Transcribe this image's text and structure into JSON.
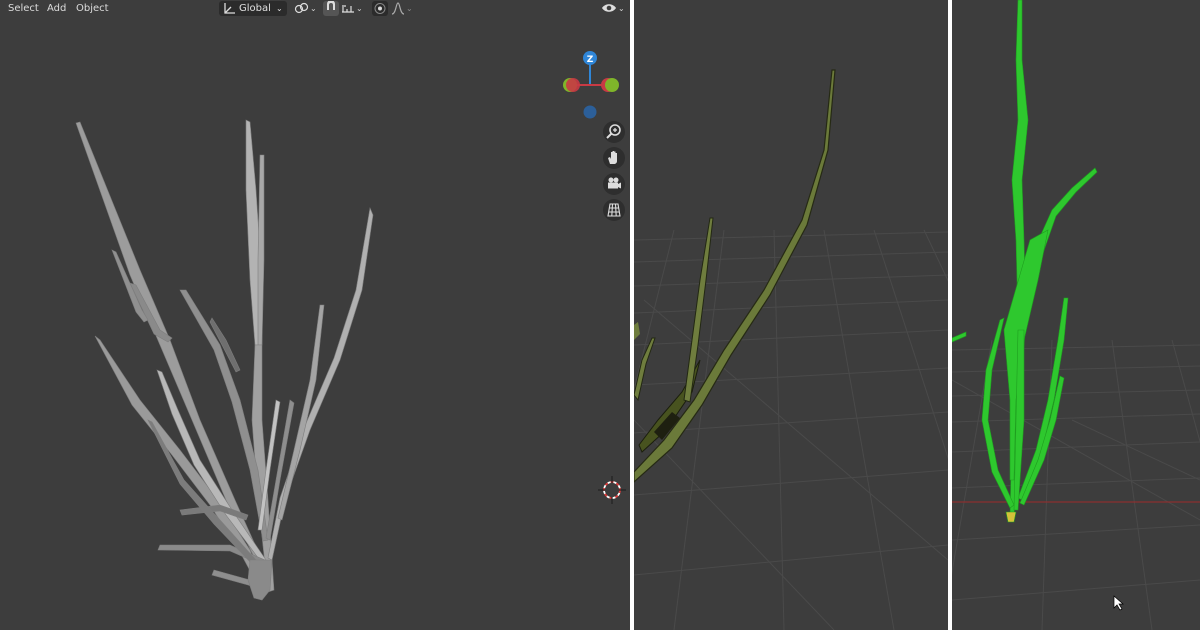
{
  "header": {
    "menu": [
      "Select",
      "Add",
      "Object"
    ],
    "orientation_label": "Global"
  },
  "gizmo": {
    "z_label": "Z"
  },
  "icons": {
    "orientation": "transform-orientation-icon",
    "pivot": "pivot-point-icon",
    "snap": "snap-magnet-icon",
    "snap_increment": "snap-increment-icon",
    "proportional": "proportional-edit-icon",
    "falloff": "falloff-curve-icon",
    "visibility": "eye-visibility-icon",
    "zoom": "zoom-icon",
    "pan": "hand-pan-icon",
    "camera": "camera-icon",
    "grid": "grid-ortho-icon",
    "cursor3d": "3d-cursor-icon",
    "mouse": "mouse-pointer-icon"
  },
  "colors": {
    "viewport_bg": "#3d3d3d",
    "grass_gray": "#a9a9a9",
    "grass_olive": "#6b7a3a",
    "grass_green": "#2ec82e",
    "axis_x": "#c83a44",
    "axis_y": "#7fb52a",
    "axis_z": "#2f86d8"
  }
}
